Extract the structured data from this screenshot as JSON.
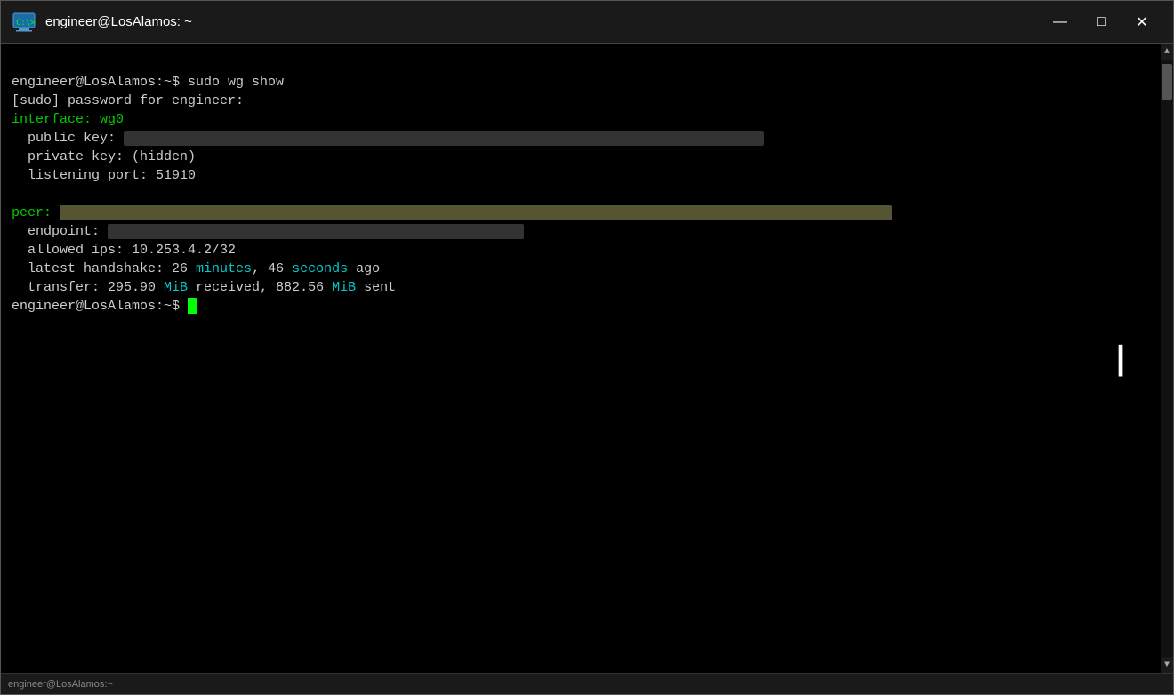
{
  "window": {
    "title": "engineer@LosAlamos: ~",
    "icon_label": "terminal-icon"
  },
  "titlebar": {
    "minimize_label": "minimize-button",
    "maximize_label": "maximize-button",
    "close_label": "close-button",
    "minimize_char": "─",
    "maximize_char": "□",
    "close_char": "✕"
  },
  "terminal": {
    "line1_prompt": "engineer@LosAlamos:~$ sudo wg show",
    "line2": "[sudo] password for engineer:",
    "line3_label": "interface: ",
    "line3_value": "wg0",
    "line4_label": "  public key: ",
    "line4_value": "████████████████████████████████████████████████████████████████████████████████████████",
    "line5": "  private key: (hidden)",
    "line6": "  listening port: 51910",
    "line7_blank": "",
    "line8_label": "peer: ",
    "line8_value": "████████████████████████████████████████████████████████████████████████████████████████████████████████",
    "line9_label": "  endpoint: ",
    "line9_value": "████████████████████████████████████████████████████",
    "line10_label": "  allowed ips: ",
    "line10_value": "10.253.4.2/32",
    "line11_label": "  latest handshake: 26 ",
    "line11_minutes": "minutes",
    "line11_mid": ", 46 ",
    "line11_seconds": "seconds",
    "line11_end": " ago",
    "line12_label": "  transfer: 295.90 ",
    "line12_mib1": "MiB",
    "line12_mid": " received, 882.56 ",
    "line12_mib2": "MiB",
    "line12_end": " sent",
    "line13_prompt": "engineer@LosAlamos:~$ "
  },
  "bottom_bar": {
    "text": "engineer@LosAlamos:~"
  }
}
